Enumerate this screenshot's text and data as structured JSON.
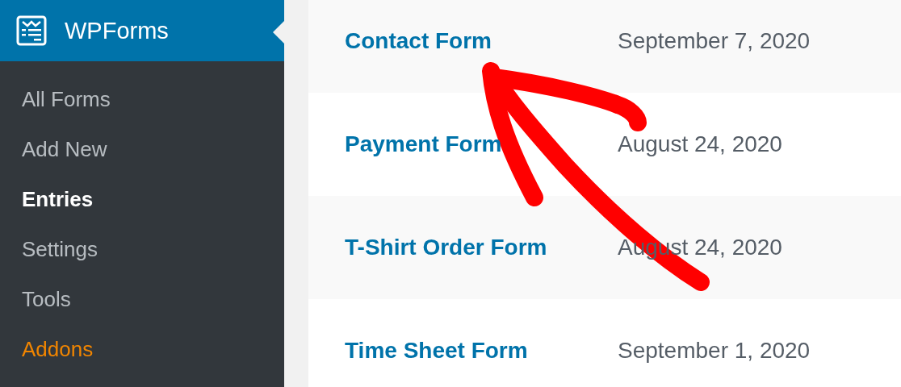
{
  "sidebar": {
    "title": "WPForms",
    "items": [
      {
        "label": "All Forms",
        "selected": false,
        "kind": "link"
      },
      {
        "label": "Add New",
        "selected": false,
        "kind": "link"
      },
      {
        "label": "Entries",
        "selected": true,
        "kind": "link"
      },
      {
        "label": "Settings",
        "selected": false,
        "kind": "link"
      },
      {
        "label": "Tools",
        "selected": false,
        "kind": "link"
      },
      {
        "label": "Addons",
        "selected": false,
        "kind": "addon"
      }
    ]
  },
  "forms": [
    {
      "name": "Contact Form",
      "date": "September 7, 2020"
    },
    {
      "name": "Payment Form",
      "date": "August 24, 2020"
    },
    {
      "name": "T-Shirt Order Form",
      "date": "August 24, 2020"
    },
    {
      "name": "Time Sheet Form",
      "date": "September 1, 2020"
    }
  ]
}
